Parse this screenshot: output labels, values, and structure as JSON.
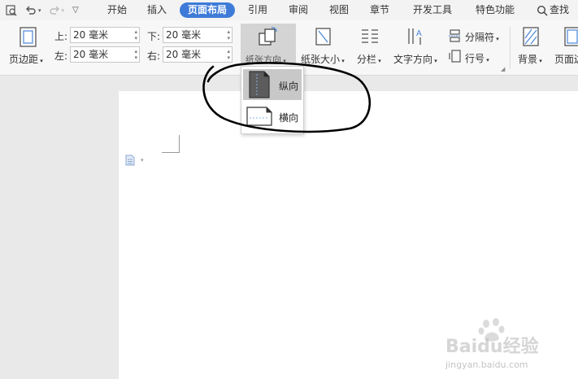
{
  "quick_access": [
    "preview-icon",
    "undo-icon",
    "redo-icon",
    "customize-icon"
  ],
  "tabs": [
    {
      "label": "开始",
      "active": false
    },
    {
      "label": "插入",
      "active": false
    },
    {
      "label": "页面布局",
      "active": true
    },
    {
      "label": "引用",
      "active": false
    },
    {
      "label": "审阅",
      "active": false
    },
    {
      "label": "视图",
      "active": false
    },
    {
      "label": "章节",
      "active": false
    },
    {
      "label": "开发工具",
      "active": false
    },
    {
      "label": "特色功能",
      "active": false
    }
  ],
  "search_label": "查找",
  "ribbon": {
    "margins_label": "页边距",
    "top_label": "上:",
    "top_value": "20 毫米",
    "bottom_label": "下:",
    "bottom_value": "20 毫米",
    "left_label": "左:",
    "left_value": "20 毫米",
    "right_label": "右:",
    "right_value": "20 毫米",
    "orientation_label": "纸张方向",
    "size_label": "纸张大小",
    "columns_label": "分栏",
    "text_direction_label": "文字方向",
    "breaks_label": "分隔符",
    "line_numbers_label": "行号",
    "background_label": "背景",
    "page_border_label": "页面边"
  },
  "orientation_menu": {
    "portrait_label": "纵向",
    "landscape_label": "横向",
    "selected": "portrait"
  },
  "watermark": {
    "brand": "Baidu经验",
    "url": "jingyan.baidu.com"
  },
  "colors": {
    "accent": "#3e7bd8",
    "annotation": "#000000"
  }
}
